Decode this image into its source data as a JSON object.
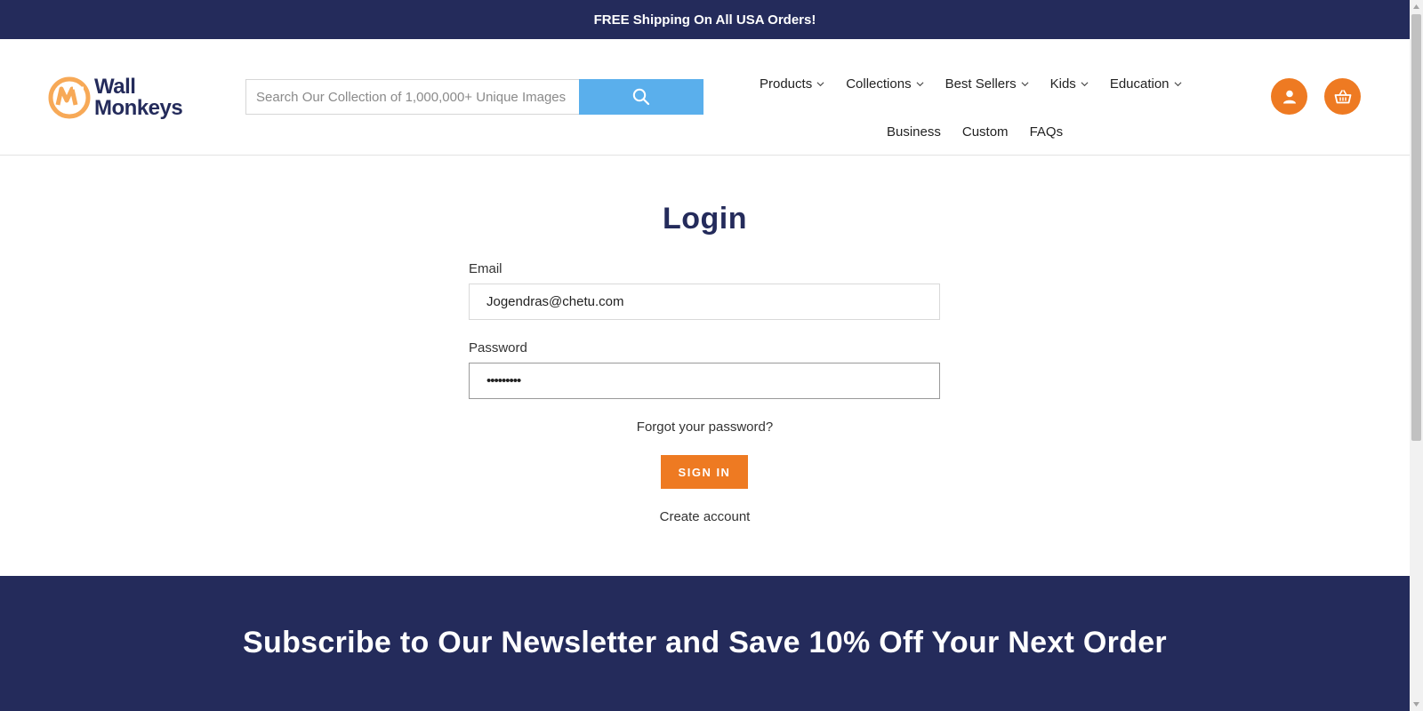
{
  "announcement": "FREE Shipping On All USA Orders!",
  "logo": {
    "line1": "Wall",
    "line2": "Monkeys"
  },
  "search": {
    "placeholder": "Search Our Collection of 1,000,000+ Unique Images",
    "icon": "search-icon"
  },
  "nav": {
    "row1": [
      {
        "label": "Products",
        "dropdown": true
      },
      {
        "label": "Collections",
        "dropdown": true
      },
      {
        "label": "Best Sellers",
        "dropdown": true
      },
      {
        "label": "Kids",
        "dropdown": true
      },
      {
        "label": "Education",
        "dropdown": true
      }
    ],
    "row2": [
      {
        "label": "Business"
      },
      {
        "label": "Custom"
      },
      {
        "label": "FAQs"
      }
    ]
  },
  "header_icons": {
    "account": "user-icon",
    "cart": "basket-icon"
  },
  "login": {
    "title": "Login",
    "email_label": "Email",
    "email_value": "Jogendras@chetu.com",
    "password_label": "Password",
    "password_value": "•••••••••",
    "forgot": "Forgot your password?",
    "signin": "SIGN IN",
    "create": "Create account"
  },
  "newsletter": {
    "heading": "Subscribe to Our Newsletter and Save 10% Off Your Next Order"
  },
  "colors": {
    "navy": "#242b5b",
    "orange": "#ee7a22",
    "search_blue": "#5aafec",
    "logo_orange": "#f7a957"
  }
}
